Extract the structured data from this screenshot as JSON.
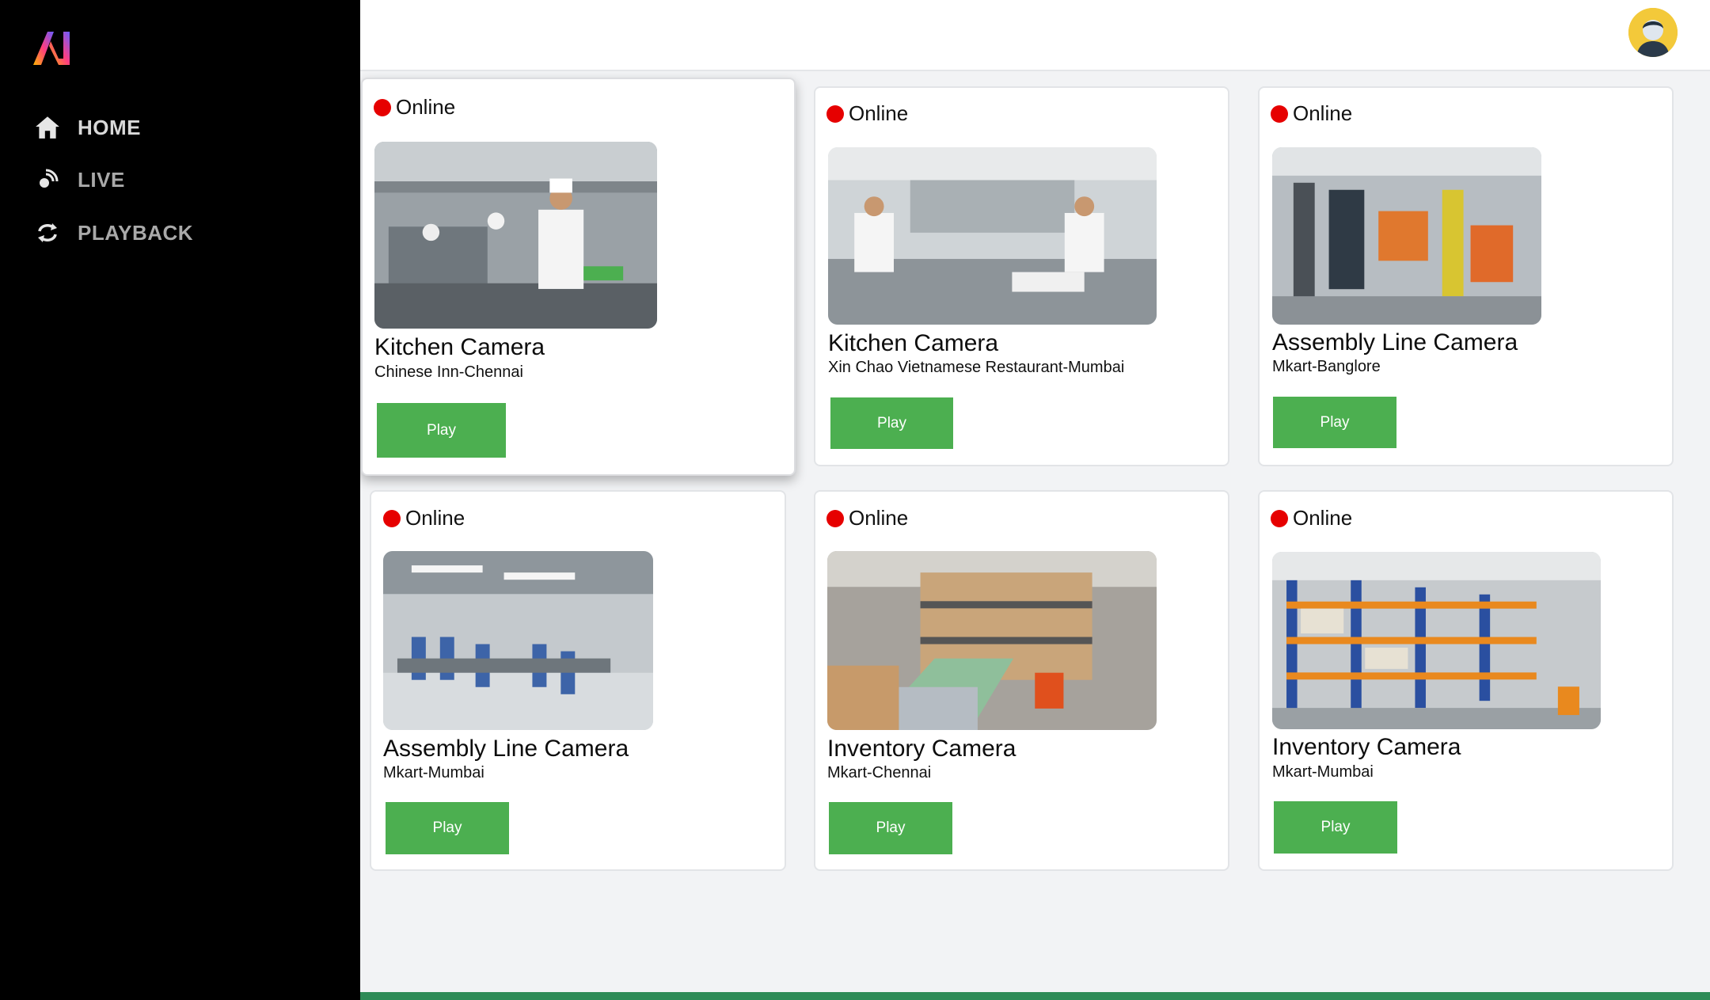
{
  "sidebar": {
    "nav": [
      {
        "label": "HOME",
        "icon": "home-icon",
        "color": "#d9d9d9"
      },
      {
        "label": "LIVE",
        "icon": "live-broadcast-icon",
        "color": "#a9a9a9"
      },
      {
        "label": "PLAYBACK",
        "icon": "replay-icon",
        "color": "#a9a9a9"
      }
    ]
  },
  "header": {
    "avatar": "user-avatar"
  },
  "cameras": [
    {
      "status": "Online",
      "title": "Kitchen Camera",
      "location": "Chinese Inn-Chennai",
      "button": "Play",
      "scene": "kitchen"
    },
    {
      "status": "Online",
      "title": "Kitchen Camera",
      "location": "Xin Chao Vietnamese Restaurant-Mumbai",
      "button": "Play",
      "scene": "kitchen"
    },
    {
      "status": "Online",
      "title": "Assembly Line Camera",
      "location": "Mkart-Banglore",
      "button": "Play",
      "scene": "machinery"
    },
    {
      "status": "Online",
      "title": "Assembly Line Camera",
      "location": "Mkart-Mumbai",
      "button": "Play",
      "scene": "factory"
    },
    {
      "status": "Online",
      "title": "Inventory Camera",
      "location": "Mkart-Chennai",
      "button": "Play",
      "scene": "warehouse"
    },
    {
      "status": "Online",
      "title": "Inventory Camera",
      "location": "Mkart-Mumbai",
      "button": "Play",
      "scene": "racks"
    }
  ],
  "colors": {
    "status_dot": "#e60000",
    "play_button": "#4caf50",
    "sidebar_bg": "#000000",
    "footer_bar": "#2e8b57"
  }
}
